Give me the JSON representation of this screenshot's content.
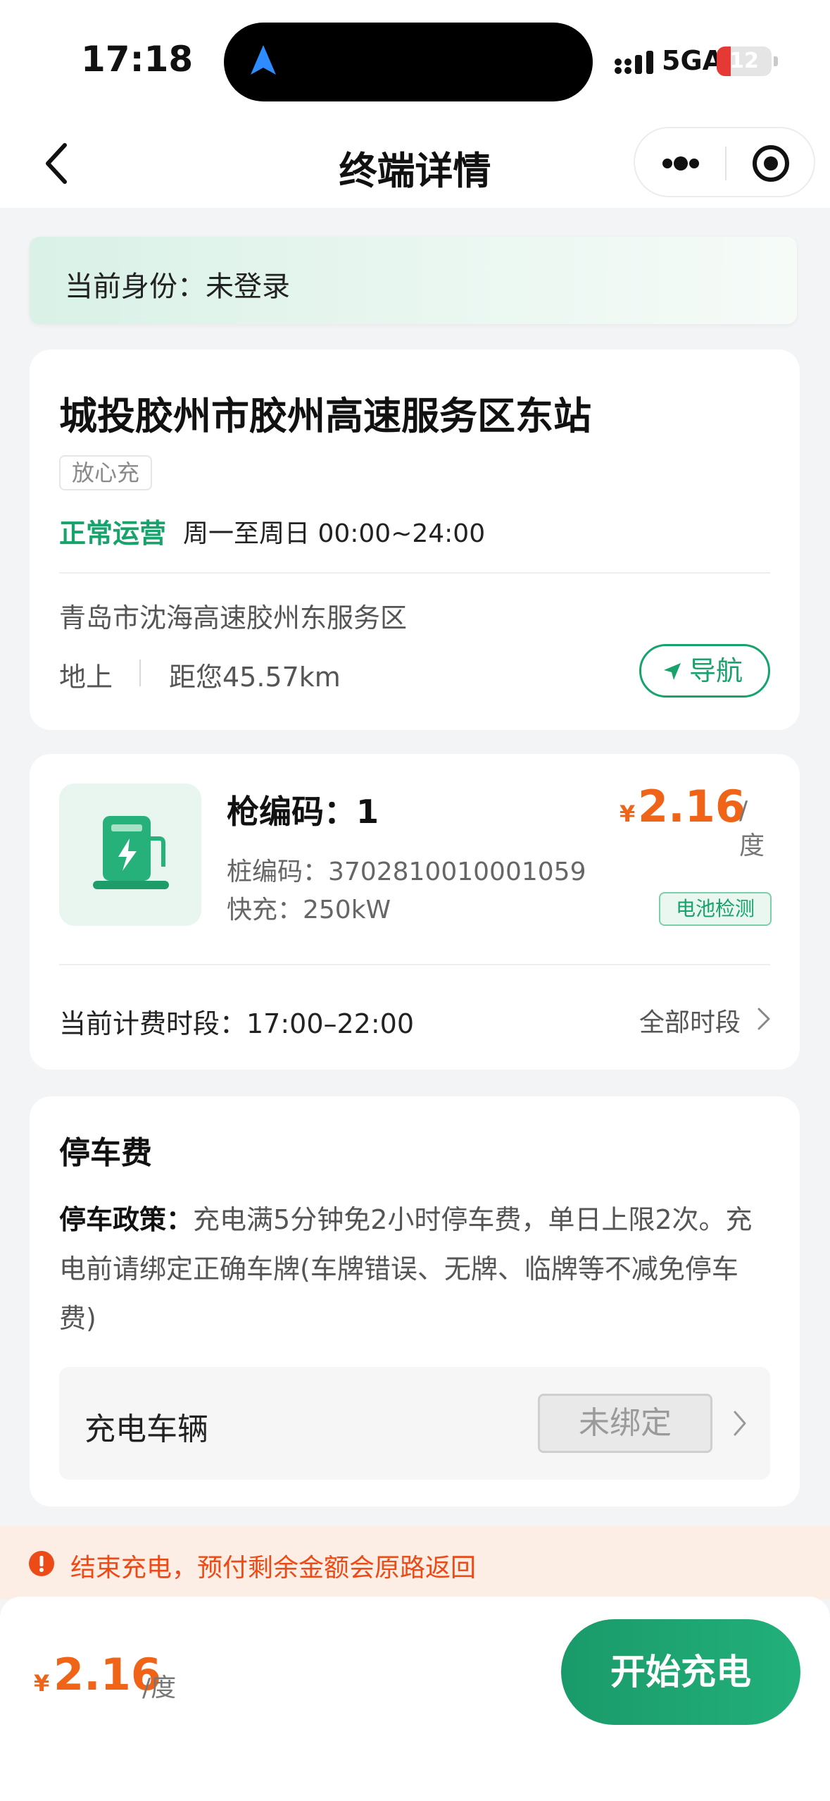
{
  "status_bar": {
    "time": "17:18",
    "network": "5GA",
    "battery": "12",
    "battery_color": "#e53935",
    "icons": [
      "location-arrow-icon",
      "signal-icon",
      "battery-icon"
    ]
  },
  "nav": {
    "title": "终端详情",
    "icons": [
      "chevron-left-icon",
      "more-dots-icon",
      "target-icon"
    ]
  },
  "identity": {
    "text": "当前身份：未登录"
  },
  "station": {
    "name": "城投胶州市胶州高速服务区东站",
    "tag": "放心充",
    "status": "正常运营",
    "hours": "周一至周日 00:00~24:00",
    "address": "青岛市沈海高速胶州东服务区",
    "location_type": "地上",
    "distance": "距您45.57km",
    "navigate_label": "导航",
    "accent_color": "#18a26c"
  },
  "gun": {
    "code": "枪编码：1",
    "price_symbol": "¥",
    "price": "2.16",
    "price_unit": "/度",
    "pile_code": "桩编码：3702810010001059",
    "fast_charge": "快充：250kW",
    "badge": "电池检测",
    "billing_period": "当前计费时段：17:00–22:00",
    "all_periods": "全部时段",
    "icon": "charging-station-icon",
    "price_color": "#f06418"
  },
  "parking": {
    "title": "停车费",
    "policy_label": "停车政策：",
    "policy_text": "充电满5分钟免2小时停车费，单日上限2次。充电前请绑定正确车牌(车牌错误、无牌、临牌等不减免停车费)",
    "vehicle_label": "充电车辆",
    "vehicle_status": "未绑定"
  },
  "notice": {
    "text": "结束充电，预付剩余金额会原路返回",
    "icon": "warning-circle-icon",
    "color": "#ec4a16"
  },
  "bottom": {
    "price_symbol": "¥",
    "price": "2.16",
    "price_unit": "/度",
    "start_label": "开始充电"
  }
}
